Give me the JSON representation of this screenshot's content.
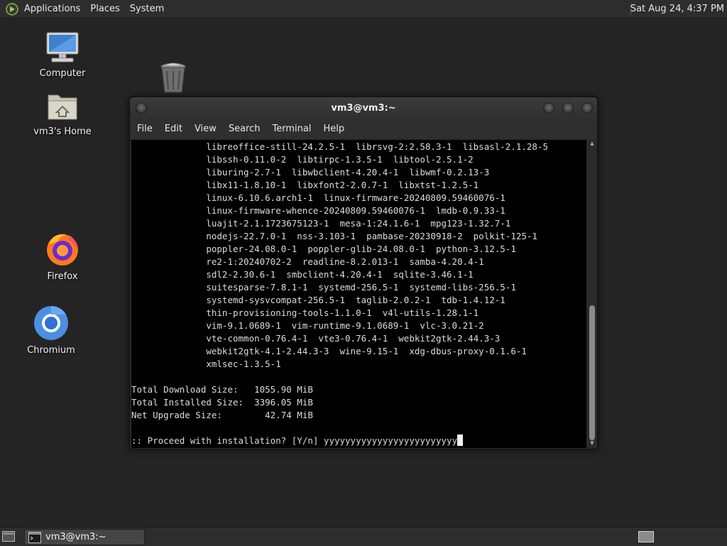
{
  "top_panel": {
    "menus": [
      "Applications",
      "Places",
      "System"
    ],
    "clock": "Sat Aug 24,  4:37 PM"
  },
  "desktop": {
    "icons": [
      {
        "label": "Computer",
        "icon": "computer-icon"
      },
      {
        "label": "vm3's Home",
        "icon": "home-folder-icon"
      },
      {
        "label": "",
        "icon": "trash-icon"
      },
      {
        "label": "Firefox",
        "icon": "firefox-icon"
      },
      {
        "label": "Chromium",
        "icon": "chromium-icon"
      }
    ]
  },
  "terminal": {
    "title": "vm3@vm3:~",
    "menus": [
      "File",
      "Edit",
      "View",
      "Search",
      "Terminal",
      "Help"
    ],
    "lines": [
      "              libreoffice-still-24.2.5-1  librsvg-2:2.58.3-1  libsasl-2.1.28-5",
      "              libssh-0.11.0-2  libtirpc-1.3.5-1  libtool-2.5.1-2",
      "              liburing-2.7-1  libwbclient-4.20.4-1  libwmf-0.2.13-3",
      "              libx11-1.8.10-1  libxfont2-2.0.7-1  libxtst-1.2.5-1",
      "              linux-6.10.6.arch1-1  linux-firmware-20240809.59460076-1",
      "              linux-firmware-whence-20240809.59460076-1  lmdb-0.9.33-1",
      "              luajit-2.1.1723675123-1  mesa-1:24.1.6-1  mpg123-1.32.7-1",
      "              nodejs-22.7.0-1  nss-3.103-1  pambase-20230918-2  polkit-125-1",
      "              poppler-24.08.0-1  poppler-glib-24.08.0-1  python-3.12.5-1",
      "              re2-1:20240702-2  readline-8.2.013-1  samba-4.20.4-1",
      "              sdl2-2.30.6-1  smbclient-4.20.4-1  sqlite-3.46.1-1",
      "              suitesparse-7.8.1-1  systemd-256.5-1  systemd-libs-256.5-1",
      "              systemd-sysvcompat-256.5-1  taglib-2.0.2-1  tdb-1.4.12-1",
      "              thin-provisioning-tools-1.1.0-1  v4l-utils-1.28.1-1",
      "              vim-9.1.0689-1  vim-runtime-9.1.0689-1  vlc-3.0.21-2",
      "              vte-common-0.76.4-1  vte3-0.76.4-1  webkit2gtk-2.44.3-3",
      "              webkit2gtk-4.1-2.44.3-3  wine-9.15-1  xdg-dbus-proxy-0.1.6-1",
      "              xmlsec-1.3.5-1",
      "",
      "Total Download Size:   1055.90 MiB",
      "Total Installed Size:  3396.05 MiB",
      "Net Upgrade Size:        42.74 MiB",
      "",
      ":: Proceed with installation? [Y/n] yyyyyyyyyyyyyyyyyyyyyyyyy"
    ]
  },
  "taskbar": {
    "tasks": [
      {
        "label": "vm3@vm3:~"
      }
    ]
  }
}
